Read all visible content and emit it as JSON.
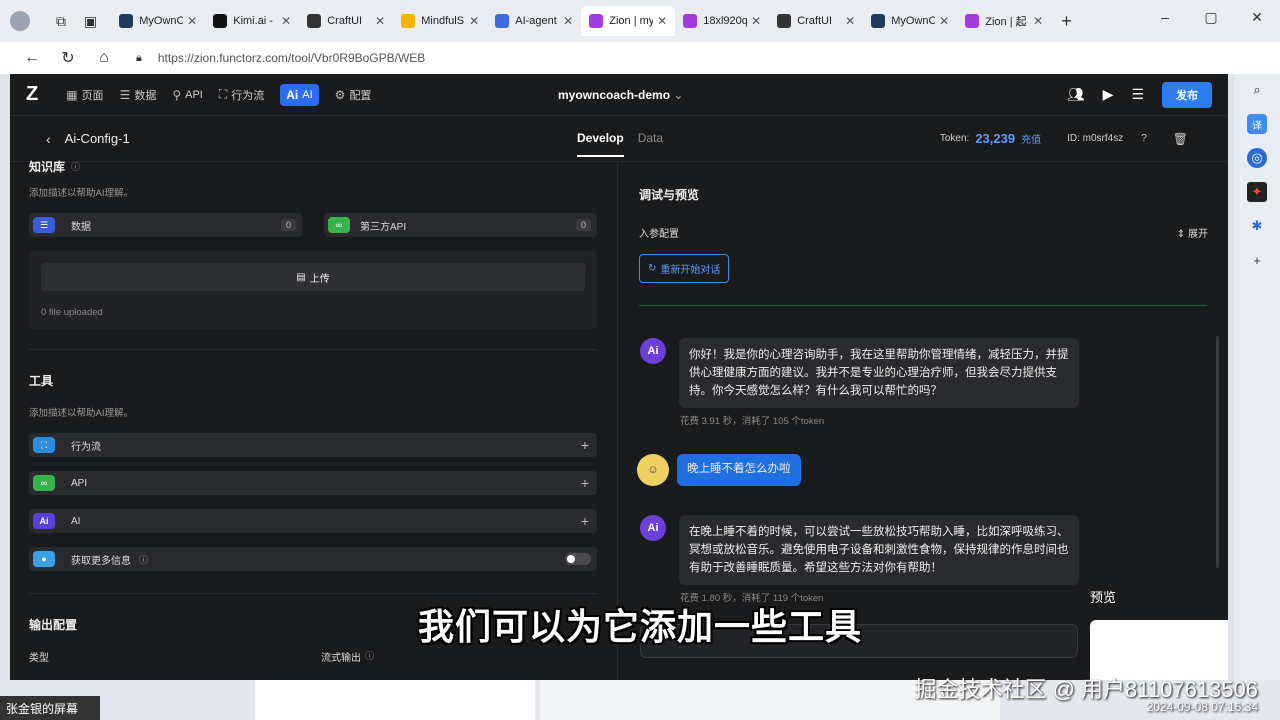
{
  "browser": {
    "tabs": [
      {
        "label": "MyOwnC",
        "icon": "doc-icon",
        "color": "#1f3a5f"
      },
      {
        "label": "Kimi.ai - I",
        "icon": "kimi-icon",
        "color": "#111111"
      },
      {
        "label": "CraftUI",
        "icon": "craft-icon",
        "color": "#333333"
      },
      {
        "label": "MindfulS",
        "icon": "emoji-icon",
        "color": "#f5b400"
      },
      {
        "label": "AI-agent",
        "icon": "doc-icon",
        "color": "#3b6ce0"
      },
      {
        "label": "Zion | my",
        "icon": "zion-icon",
        "color": "#a23ce0"
      },
      {
        "label": "18xl920q",
        "icon": "zion-icon",
        "color": "#a23ce0"
      },
      {
        "label": "CraftUI",
        "icon": "craft-icon",
        "color": "#333333"
      },
      {
        "label": "MyOwnC",
        "icon": "doc-icon",
        "color": "#1f3a5f"
      },
      {
        "label": "Zion | 起",
        "icon": "zion-icon",
        "color": "#a23ce0"
      }
    ],
    "url": "https://zion.functorz.com/tool/Vbr0R9BoGPB/WEB"
  },
  "app": {
    "nav": {
      "pages": "页面",
      "data": "数据",
      "api": "API",
      "flow": "行为流",
      "ai": "AI",
      "config": "配置"
    },
    "project_name": "myowncoach-demo",
    "publish": "发布",
    "config_name": "Ai-Config-1",
    "tab_develop": "Develop",
    "tab_data": "Data",
    "token_label": "Token:",
    "token_value": "23,239",
    "recharge": "充值",
    "id_label": "ID: m0srf4sz"
  },
  "left": {
    "knowledge_title": "知识库",
    "knowledge_desc": "添加描述以帮助AI理解。",
    "data_label": "数据",
    "data_count": "0",
    "thirdapi_label": "第三方API",
    "thirdapi_count": "0",
    "upload_label": "上传",
    "upload_status": "0 file uploaded",
    "tools_title": "工具",
    "tools_desc": "添加描述以帮助AI理解。",
    "tools": [
      "行为流",
      "API",
      "AI"
    ],
    "more_info": "获取更多信息",
    "output_title": "输出配置",
    "type_label": "类型",
    "stream_label": "流式输出"
  },
  "right": {
    "title": "调试与预览",
    "params": "入参配置",
    "expand": "展开",
    "restart": "重新开始对话",
    "messages": [
      {
        "role": "ai",
        "text": "你好！我是你的心理咨询助手，我在这里帮助你管理情绪，减轻压力，并提供心理健康方面的建议。我并不是专业的心理治疗师，但我会尽力提供支持。你今天感觉怎么样？有什么我可以帮忙的吗？",
        "meta": "花费 3.91 秒，消耗了 105 个token"
      },
      {
        "role": "user",
        "text": "晚上睡不着怎么办啦"
      },
      {
        "role": "ai",
        "text": "在晚上睡不着的时候，可以尝试一些放松技巧帮助入睡，比如深呼吸练习、冥想或放松音乐。避免使用电子设备和刺激性食物，保持规律的作息时间也有助于改善睡眠质量。希望这些方法对你有帮助！",
        "meta": "花费 1.80 秒，消耗了 119 个token"
      }
    ],
    "preview": "预览"
  },
  "caption": "我们可以为它添加一些工具",
  "watermark": "掘金技术社区 @ 用户81107613506",
  "clock": "2024-09-08 07:16:34",
  "taskbar_user": "张金银的屏幕"
}
